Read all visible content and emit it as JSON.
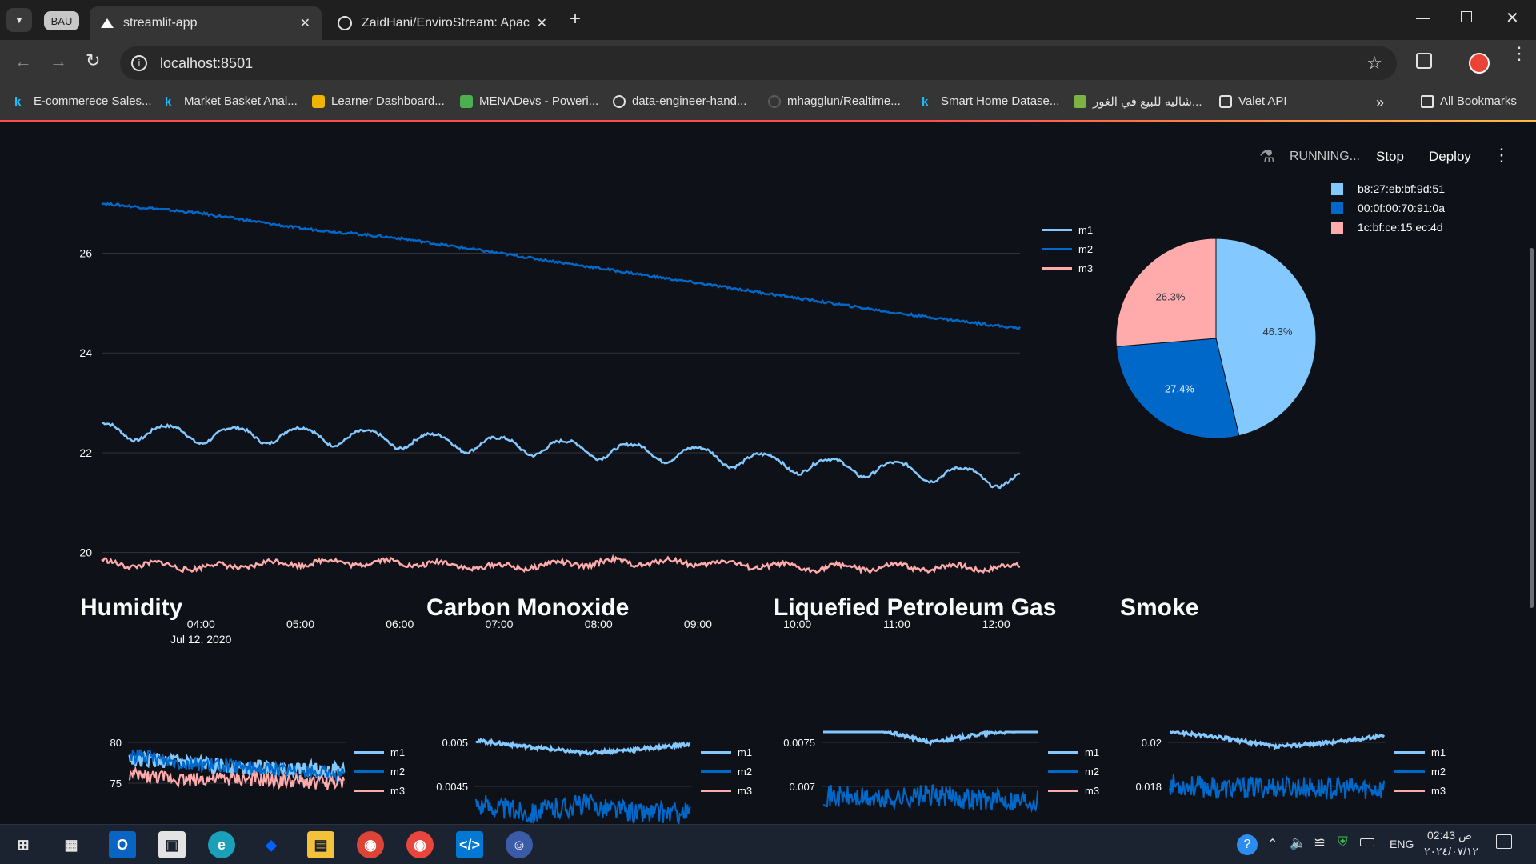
{
  "browser": {
    "profile_badge": "BAU",
    "tabs": [
      {
        "title": "streamlit-app"
      },
      {
        "title": "ZaidHani/EnviroStream: Apache"
      }
    ],
    "address": "localhost:8501",
    "bookmarks": [
      {
        "label": "E-commerece Sales...",
        "icon": "kaggle-icon"
      },
      {
        "label": "Market Basket Anal...",
        "icon": "kaggle-icon"
      },
      {
        "label": "Learner Dashboard...",
        "icon": "box-icon"
      },
      {
        "label": "MENADevs - Poweri...",
        "icon": "menadevs-icon"
      },
      {
        "label": "data-engineer-hand...",
        "icon": "github-icon"
      },
      {
        "label": "mhagglun/Realtime...",
        "icon": "github-icon"
      },
      {
        "label": "Smart Home Datase...",
        "icon": "kaggle-icon"
      },
      {
        "label": "شاليه للبيع في الغور...",
        "icon": "opensooq-icon"
      },
      {
        "label": "Valet API",
        "icon": "valet-icon"
      }
    ],
    "all_bookmarks": "All Bookmarks"
  },
  "app_header": {
    "status": "RUNNING...",
    "stop": "Stop",
    "deploy": "Deploy"
  },
  "colors": {
    "m1": "#83c9ff",
    "m2": "#0068c9",
    "m3": "#ffabab"
  },
  "legend_series": [
    "m1",
    "m2",
    "m3"
  ],
  "chart_data": [
    {
      "type": "line",
      "title": "",
      "x_ticks": [
        "04:00",
        "05:00",
        "06:00",
        "07:00",
        "08:00",
        "09:00",
        "10:00",
        "11:00",
        "12:00"
      ],
      "x_sub_label": "Jul 12, 2020",
      "y_ticks": [
        20,
        22,
        24,
        26
      ],
      "ylim": [
        19,
        27.5
      ],
      "series": [
        {
          "name": "m1",
          "x": [
            3.0,
            4.0,
            5.0,
            6.0,
            7.0,
            8.0,
            9.0,
            10.0,
            11.0,
            12.2
          ],
          "y": [
            22.6,
            22.5,
            22.5,
            22.4,
            22.3,
            22.2,
            22.1,
            21.9,
            21.8,
            21.6
          ]
        },
        {
          "name": "m2",
          "x": [
            3.0,
            4.0,
            5.0,
            6.0,
            7.0,
            8.0,
            9.0,
            10.0,
            11.0,
            12.2
          ],
          "y": [
            27.0,
            26.8,
            26.5,
            26.3,
            26.0,
            25.7,
            25.4,
            25.1,
            24.8,
            24.5
          ]
        },
        {
          "name": "m3",
          "x": [
            3.0,
            4.0,
            5.0,
            6.0,
            7.0,
            8.0,
            9.0,
            10.0,
            11.0,
            12.2
          ],
          "y": [
            19.8,
            19.7,
            19.8,
            19.8,
            19.7,
            19.8,
            19.8,
            19.7,
            19.7,
            19.7
          ]
        }
      ]
    },
    {
      "type": "pie",
      "legend": [
        "b8:27:eb:bf:9d:51",
        "00:0f:00:70:91:0a",
        "1c:bf:ce:15:ec:4d"
      ],
      "values": [
        46.3,
        27.4,
        26.3
      ],
      "labels": [
        "46.3%",
        "27.4%",
        "26.3%"
      ]
    },
    {
      "type": "line",
      "title": "Humidity",
      "y_ticks": [
        80,
        75
      ],
      "series": [
        {
          "name": "m1",
          "values": [
            78.0,
            77.5,
            77.0,
            76.8,
            76.5
          ]
        },
        {
          "name": "m2",
          "values": [
            78.5,
            77.5,
            77.0,
            76.5,
            76.0
          ]
        },
        {
          "name": "m3",
          "values": [
            76.0,
            75.5,
            75.5,
            75.2,
            75.0
          ]
        }
      ]
    },
    {
      "type": "line",
      "title": "Carbon Monoxide",
      "y_ticks": [
        0.005,
        0.0045
      ],
      "series": [
        {
          "name": "m1",
          "values": [
            0.00502,
            0.00495,
            0.00488,
            0.00492,
            0.00498
          ]
        },
        {
          "name": "m2",
          "values": [
            0.0043,
            0.0042,
            0.0043,
            0.0042,
            0.0042
          ]
        }
      ]
    },
    {
      "type": "line",
      "title": "Liquefied Petroleum Gas",
      "y_ticks": [
        0.0075,
        0.007
      ],
      "series": [
        {
          "name": "m1",
          "values": [
            0.0077,
            0.00765,
            0.0075,
            0.0076,
            0.00765
          ]
        },
        {
          "name": "m2",
          "values": [
            0.0069,
            0.00685,
            0.0069,
            0.00685,
            0.00685
          ]
        }
      ]
    },
    {
      "type": "line",
      "title": "Smoke",
      "y_ticks": [
        0.02,
        0.018
      ],
      "series": [
        {
          "name": "m1",
          "values": [
            0.0205,
            0.0202,
            0.0198,
            0.02,
            0.0203
          ]
        },
        {
          "name": "m2",
          "values": [
            0.0181,
            0.0179,
            0.018,
            0.0179,
            0.0179
          ]
        }
      ]
    }
  ],
  "taskbar": {
    "language": "ENG",
    "time": "02:43 ص",
    "date": "٢٠٢٤/٠٧/١٢"
  }
}
